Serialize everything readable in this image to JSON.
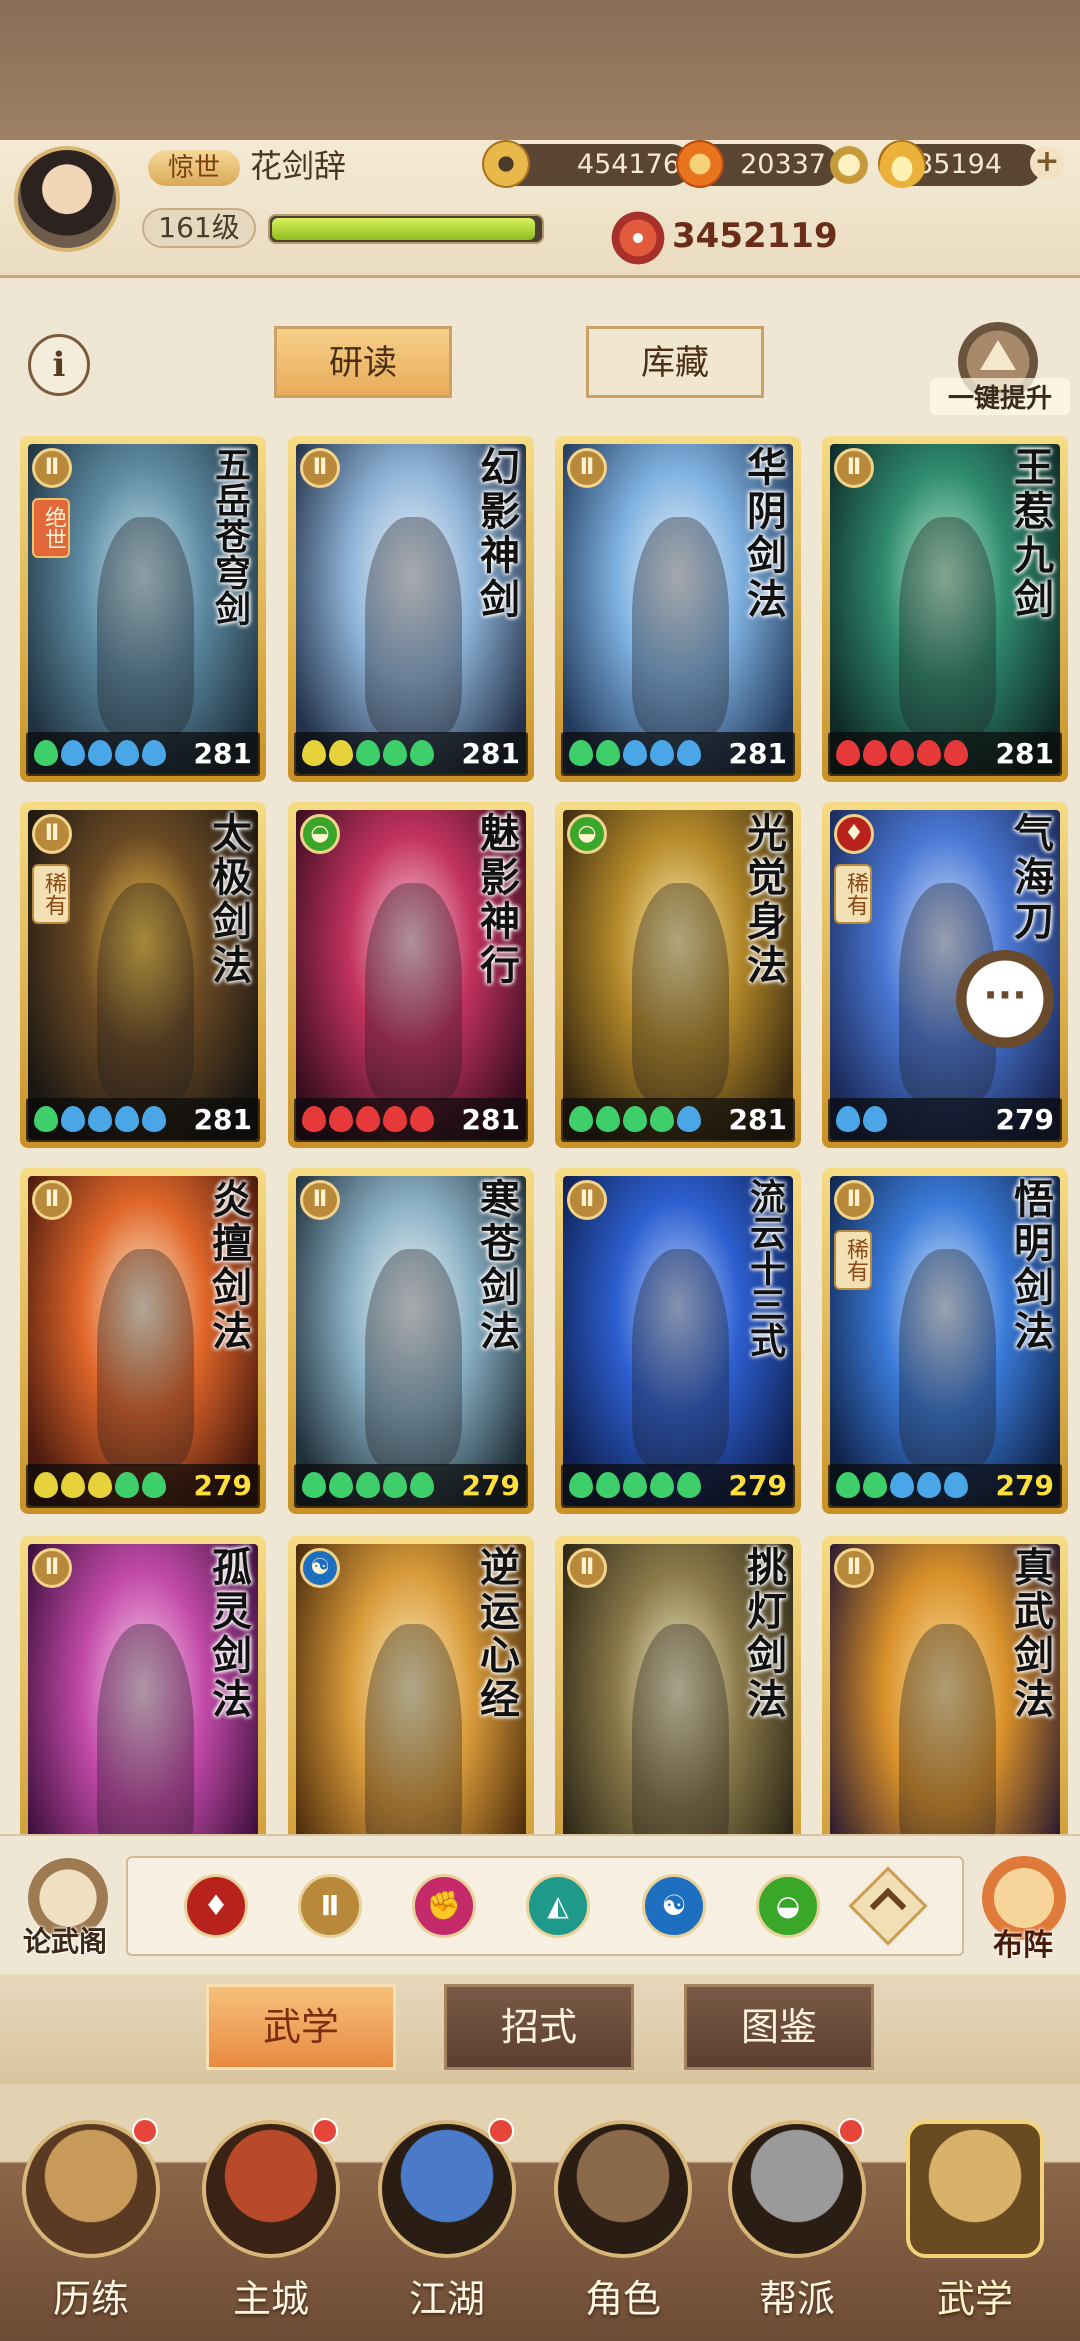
{
  "player": {
    "title_badge": "惊世",
    "name": "花剑辞",
    "level": "161级",
    "xp_progress": 0.98
  },
  "resources": [
    {
      "icon": "copper-coin-icon",
      "value": "454176"
    },
    {
      "icon": "spirit-leaf-icon",
      "value": "20337"
    },
    {
      "icon": "gold-ingot-icon",
      "value": "335194"
    }
  ],
  "combat_power": "3452119",
  "top_tabs": {
    "study": "研读",
    "storage": "库藏"
  },
  "upgrade_label": "一键提升",
  "cards": [
    {
      "name": "五岳苍穹剑",
      "type": "sword",
      "rarity": "绝世",
      "gems": [
        "green",
        "blue",
        "blue",
        "blue",
        "blue"
      ],
      "level": "281",
      "palette": [
        "#1f3340",
        "#5e8ba3",
        "#c9e6ef"
      ]
    },
    {
      "name": "幻影神剑",
      "type": "sword",
      "rarity": "",
      "gems": [
        "yellow",
        "yellow",
        "green",
        "green",
        "green"
      ],
      "level": "281",
      "palette": [
        "#23324a",
        "#8fb4d8",
        "#f3f7fb"
      ]
    },
    {
      "name": "华阴剑法",
      "type": "sword",
      "rarity": "",
      "gems": [
        "green",
        "green",
        "blue",
        "blue",
        "blue"
      ],
      "level": "281",
      "palette": [
        "#223a5c",
        "#7fb1e0",
        "#eef5fb"
      ]
    },
    {
      "name": "王惹九剑",
      "type": "sword",
      "rarity": "",
      "gems": [
        "red",
        "red",
        "red",
        "red",
        "red"
      ],
      "level": "281",
      "palette": [
        "#0f2a28",
        "#2f8a6e",
        "#b9f0cf"
      ]
    },
    {
      "name": "太极剑法",
      "type": "sword",
      "rarity": "稀有",
      "gems": [
        "green",
        "blue",
        "blue",
        "blue",
        "blue"
      ],
      "level": "281",
      "palette": [
        "#1a1612",
        "#6b4a24",
        "#f1c44a"
      ]
    },
    {
      "name": "魅影神行",
      "type": "lightfoot",
      "rarity": "",
      "gems": [
        "red",
        "red",
        "red",
        "red",
        "red"
      ],
      "level": "281",
      "palette": [
        "#3a0e20",
        "#c2325f",
        "#ffd1de"
      ]
    },
    {
      "name": "光觉身法",
      "type": "lightfoot",
      "rarity": "",
      "gems": [
        "green",
        "green",
        "green",
        "green",
        "blue"
      ],
      "level": "281",
      "palette": [
        "#3a2a10",
        "#b58a2a",
        "#fff0b0"
      ]
    },
    {
      "name": "气海刀",
      "type": "blade",
      "rarity": "稀有",
      "gems": [
        "blue",
        "blue"
      ],
      "level": "279",
      "palette": [
        "#1b2a5a",
        "#4a78d4",
        "#d8e6ff"
      ]
    },
    {
      "name": "炎擅剑法",
      "type": "sword",
      "rarity": "",
      "gems": [
        "yellow",
        "yellow",
        "yellow",
        "green",
        "green"
      ],
      "level": "279",
      "palette": [
        "#4a1a0e",
        "#e0662a",
        "#fff3d8"
      ]
    },
    {
      "name": "寒苍剑法",
      "type": "sword",
      "rarity": "",
      "gems": [
        "green",
        "green",
        "green",
        "green",
        "green"
      ],
      "level": "279",
      "palette": [
        "#20303a",
        "#8ab0c4",
        "#f4f8fa"
      ]
    },
    {
      "name": "流云十三式",
      "type": "sword",
      "rarity": "",
      "gems": [
        "green",
        "green",
        "green",
        "green",
        "green"
      ],
      "level": "279",
      "palette": [
        "#0f2050",
        "#2d5fd0",
        "#bcd4ff"
      ]
    },
    {
      "name": "悟明剑法",
      "type": "sword",
      "rarity": "稀有",
      "gems": [
        "green",
        "green",
        "blue",
        "blue",
        "blue"
      ],
      "level": "279",
      "palette": [
        "#10244a",
        "#3a7ad8",
        "#dcecff"
      ]
    },
    {
      "name": "孤灵剑法",
      "type": "sword",
      "rarity": "",
      "gems": [],
      "level": "",
      "palette": [
        "#3a0e3a",
        "#c24aa8",
        "#ffd6f2"
      ]
    },
    {
      "name": "逆运心经",
      "type": "inner",
      "rarity": "",
      "gems": [],
      "level": "",
      "palette": [
        "#4a2a0a",
        "#d89a3a",
        "#fff4c4"
      ]
    },
    {
      "name": "挑灯剑法",
      "type": "sword",
      "rarity": "",
      "gems": [],
      "level": "",
      "palette": [
        "#2a2414",
        "#8a7a4a",
        "#f4ecc4"
      ]
    },
    {
      "name": "真武剑法",
      "type": "sword",
      "rarity": "",
      "gems": [],
      "level": "",
      "palette": [
        "#2a1a30",
        "#d8902a",
        "#ffe2a0"
      ]
    }
  ],
  "type_glyphs": {
    "sword": "Ⅱ",
    "lightfoot": "◒",
    "blade": "♦",
    "inner": "☯"
  },
  "gem_colors": {
    "green": "#3fcf6a",
    "blue": "#4aa6e6",
    "yellow": "#e6d23a",
    "red": "#e63a3a"
  },
  "filters": [
    {
      "name": "blade-filter-icon",
      "glyph": "♦",
      "color": "#b8221c"
    },
    {
      "name": "sword-filter-icon",
      "glyph": "Ⅱ",
      "color": "#b8893a"
    },
    {
      "name": "fist-filter-icon",
      "glyph": "✊",
      "color": "#c42a6a"
    },
    {
      "name": "fan-filter-icon",
      "glyph": "◭",
      "color": "#1f9a8a"
    },
    {
      "name": "inner-filter-icon",
      "glyph": "☯",
      "color": "#1e6fbf"
    },
    {
      "name": "lightfoot-filter-icon",
      "glyph": "◒",
      "color": "#3aa62a"
    }
  ],
  "lunwu_label": "论武阁",
  "buzhen_label": "布阵",
  "subtabs": [
    "武学",
    "招式",
    "图鉴"
  ],
  "nav": [
    {
      "label": "历练",
      "badge": true,
      "active": false,
      "colors": [
        "#c89a5a",
        "#5a3a22"
      ]
    },
    {
      "label": "主城",
      "badge": true,
      "active": false,
      "colors": [
        "#b84a2a",
        "#3a2214"
      ]
    },
    {
      "label": "江湖",
      "badge": true,
      "active": false,
      "colors": [
        "#4a7ac8",
        "#2a1e14"
      ]
    },
    {
      "label": "角色",
      "badge": false,
      "active": false,
      "colors": [
        "#8a6a4a",
        "#2a1e14"
      ]
    },
    {
      "label": "帮派",
      "badge": true,
      "active": false,
      "colors": [
        "#9a9a9a",
        "#2a1e14"
      ]
    },
    {
      "label": "武学",
      "badge": false,
      "active": true,
      "colors": [
        "#d8b26a",
        "#6a4a20"
      ]
    }
  ]
}
